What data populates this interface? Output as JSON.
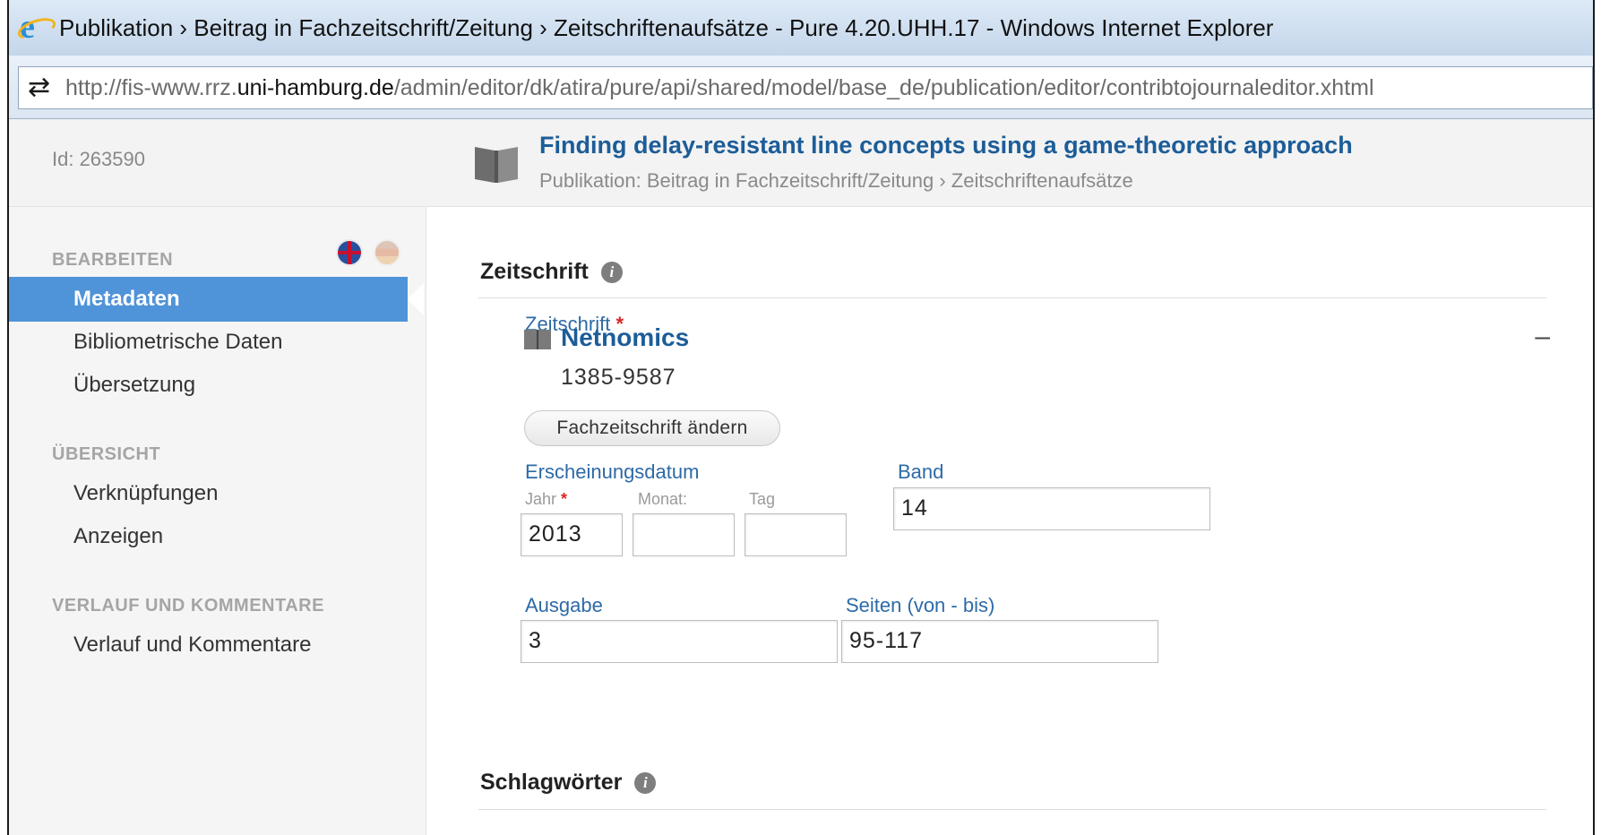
{
  "window": {
    "title": "Publikation › Beitrag in Fachzeitschrift/Zeitung › Zeitschriftenaufsätze - Pure 4.20.UHH.17 - Windows Internet Explorer"
  },
  "address": {
    "url_prefix": "http://fis-www.rrz.",
    "url_domain": "uni-hamburg.de",
    "url_path": "/admin/editor/dk/atira/pure/api/shared/model/base_de/publication/editor/contribtojournaleditor.xhtml"
  },
  "header": {
    "id_label": "Id: 263590",
    "title": "Finding delay-resistant line concepts using a game-theoretic approach",
    "breadcrumb": "Publikation: Beitrag in Fachzeitschrift/Zeitung › Zeitschriftenaufsätze"
  },
  "sidebar": {
    "section_edit": "BEARBEITEN",
    "items_edit": [
      "Metadaten",
      "Bibliometrische Daten",
      "Übersetzung"
    ],
    "section_overview": "ÜBERSICHT",
    "items_overview": [
      "Verknüpfungen",
      "Anzeigen"
    ],
    "section_history": "VERLAUF UND KOMMENTARE",
    "items_history": [
      "Verlauf und Kommentare"
    ]
  },
  "journal_section": {
    "heading": "Zeitschrift",
    "info_glyph": "i",
    "field_label": "Zeitschrift",
    "required_mark": "*",
    "journal_name": "Netnomics",
    "issn": "1385-9587",
    "collapse_glyph": "–",
    "change_button": "Fachzeitschrift ändern"
  },
  "date": {
    "label": "Erscheinungsdatum",
    "year_label": "Jahr",
    "month_label": "Monat:",
    "day_label": "Tag",
    "year_value": "2013",
    "month_value": "",
    "day_value": ""
  },
  "volume": {
    "label": "Band",
    "value": "14"
  },
  "issue": {
    "label": "Ausgabe",
    "value": "3"
  },
  "pages": {
    "label": "Seiten (von - bis)",
    "value": "95-117"
  },
  "keywords_section": {
    "heading": "Schlagwörter",
    "info_glyph": "i"
  },
  "colors": {
    "accent": "#4f93d8",
    "link": "#1c5d98",
    "label": "#2d6aa6",
    "required": "#d9262a"
  }
}
